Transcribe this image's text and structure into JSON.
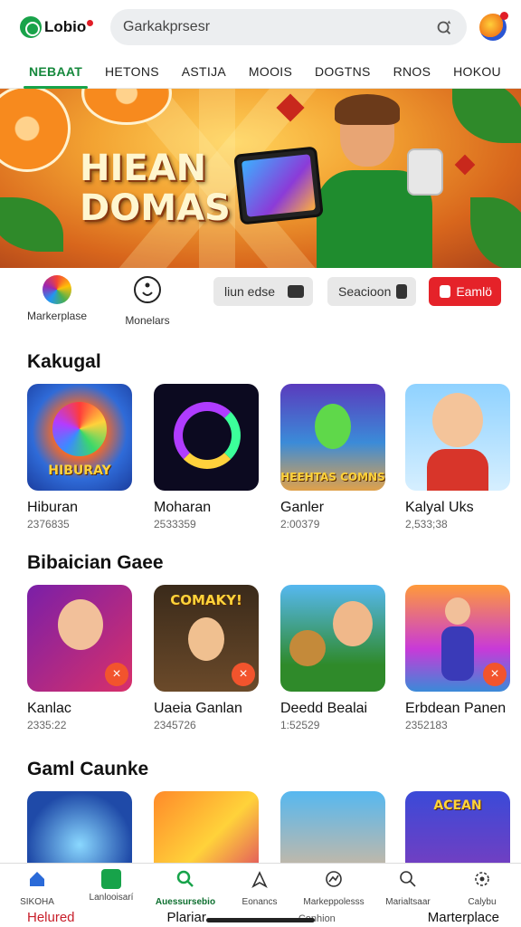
{
  "header": {
    "logo_text": "Lobio",
    "search_placeholder": "Garkakprsesr"
  },
  "tabs": [
    {
      "label": "NEBAAT",
      "active": true
    },
    {
      "label": "HETONS"
    },
    {
      "label": "ASTIJA"
    },
    {
      "label": "MOOIS"
    },
    {
      "label": "DOGTNS"
    },
    {
      "label": "RNOS"
    },
    {
      "label": "HOKOU"
    }
  ],
  "hero": {
    "title_line1": "HIEAN",
    "title_line2": "DOMAS"
  },
  "shortcuts": {
    "items": [
      {
        "label": "Markerplase",
        "icon": "colorful-ball-icon"
      },
      {
        "label": "Monelars",
        "icon": "smiley-icon"
      }
    ],
    "chips": [
      {
        "label": "liun edse",
        "icon": "gamepad-icon"
      },
      {
        "label": "Seacioon",
        "icon": "robot-icon"
      },
      {
        "label": "Eamlö",
        "icon": "game-controller-icon"
      }
    ]
  },
  "sections": [
    {
      "title": "Kakugal",
      "cards": [
        {
          "title": "Hiburan",
          "count": "2376835",
          "thumb_text": "HIBURAY"
        },
        {
          "title": "Moharan",
          "count": "2533359"
        },
        {
          "title": "Ganler",
          "count": "2:00379",
          "thumb_text": "HEEHTAS COMNS"
        },
        {
          "title": "Kalyal Uks",
          "count": "2,533;38"
        }
      ]
    },
    {
      "title": "Bibaician Gaee",
      "cards": [
        {
          "title": "Kanlac",
          "count": "2335:22"
        },
        {
          "title": "Uaeia Ganlan",
          "count": "2345726",
          "thumb_text": "COMAKY!"
        },
        {
          "title": "Deedd Bealai",
          "count": "1:52529"
        },
        {
          "title": "Erbdean Panen",
          "count": "2352183"
        }
      ]
    },
    {
      "title": "Gaml Caunke",
      "cards": [
        {
          "title": ""
        },
        {
          "title": ""
        },
        {
          "title": ""
        },
        {
          "title": "",
          "thumb_text": "ACEAN"
        }
      ]
    }
  ],
  "bottom_nav": [
    {
      "label": "SIKOHA",
      "icon": "home-icon"
    },
    {
      "label": "Lanlooisarí",
      "icon": "bag-icon"
    },
    {
      "label": "Auessursebio",
      "icon": "search-icon",
      "active": true
    },
    {
      "label": "Eonancs",
      "icon": "bookmark-icon"
    },
    {
      "label": "Markeppolesss",
      "icon": "chart-icon"
    },
    {
      "label": "Marialtsaar",
      "icon": "magnifier-icon"
    },
    {
      "label": "Calybu",
      "icon": "settings-icon"
    }
  ],
  "footer": [
    "Helured",
    "Plariar",
    "Conhion",
    "Marterplace"
  ],
  "colors": {
    "accent": "#17a34a",
    "danger": "#e52229",
    "badge": "#f2542d"
  }
}
